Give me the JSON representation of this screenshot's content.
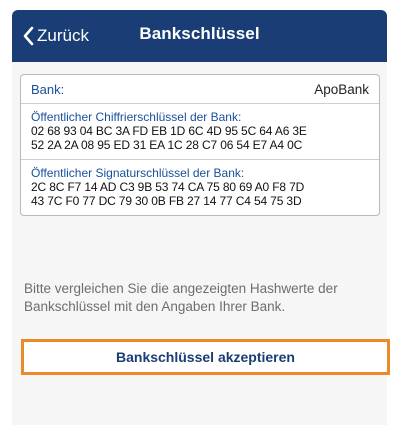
{
  "navbar": {
    "back_label": "Zurück",
    "title": "Bankschlüssel",
    "back_icon": "chevron-left-icon",
    "background_color": "#1a3d75"
  },
  "bank": {
    "label": "Bank:",
    "name": "ApoBank"
  },
  "encryption_key": {
    "title": "Öffentlicher Chiffrierschlüssel der Bank:",
    "lines": [
      "02 68 93 04 BC 3A FD EB 1D 6C 4D 95 5C 64 A6 3E",
      "52 2A 2A 08 95 ED 31 EA 1C 28 C7 06 54 E7 A4 0C"
    ]
  },
  "signature_key": {
    "title": "Öffentlicher Signaturschlüssel der Bank:",
    "lines": [
      "2C 8C F7 14 AD C3 9B 53 74 CA 75 80 69 A0 F8 7D",
      "43 7C F0 77 DC 79 30 0B FB 27 14 77 C4 54 75 3D"
    ]
  },
  "hint": "Bitte vergleichen Sie die angezeigten Hashwerte der Bankschlüssel mit den Angaben Ihrer Bank.",
  "accept_button": {
    "label": "Bankschlüssel akzeptieren",
    "highlight_color": "#ec8a2a"
  }
}
